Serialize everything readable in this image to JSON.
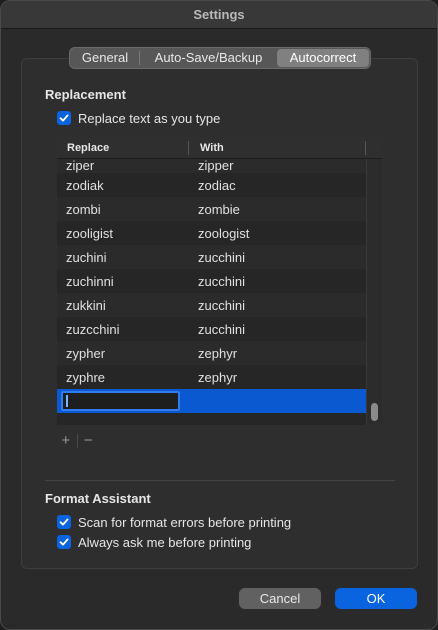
{
  "window": {
    "title": "Settings"
  },
  "tabs": [
    {
      "label": "General"
    },
    {
      "label": "Auto-Save/Backup"
    },
    {
      "label": "Autocorrect",
      "selected": true
    }
  ],
  "replacement": {
    "title": "Replacement",
    "replace_as_you_type": {
      "label": "Replace text as you type",
      "checked": true
    },
    "table": {
      "columns": [
        "Replace",
        "With"
      ],
      "rows": [
        {
          "replace": "ziper",
          "with": "zipper"
        },
        {
          "replace": "zodiak",
          "with": "zodiac"
        },
        {
          "replace": "zombi",
          "with": "zombie"
        },
        {
          "replace": "zooligist",
          "with": "zoologist"
        },
        {
          "replace": "zuchini",
          "with": "zucchini"
        },
        {
          "replace": "zuchinni",
          "with": "zucchini"
        },
        {
          "replace": "zukkini",
          "with": "zucchini"
        },
        {
          "replace": "zuzcchini",
          "with": "zucchini"
        },
        {
          "replace": "zypher",
          "with": "zephyr"
        },
        {
          "replace": "zyphre",
          "with": "zephyr"
        }
      ],
      "editing_row": {
        "replace": "",
        "with": ""
      }
    },
    "add_label": "+",
    "remove_label": "−"
  },
  "format_assistant": {
    "title": "Format Assistant",
    "scan_errors": {
      "label": "Scan for format errors before printing",
      "checked": true
    },
    "always_ask": {
      "label": "Always ask me before printing",
      "checked": true
    }
  },
  "buttons": {
    "cancel": "Cancel",
    "ok": "OK"
  },
  "colors": {
    "accent": "#0a64e0",
    "selection": "#0a59d1"
  }
}
